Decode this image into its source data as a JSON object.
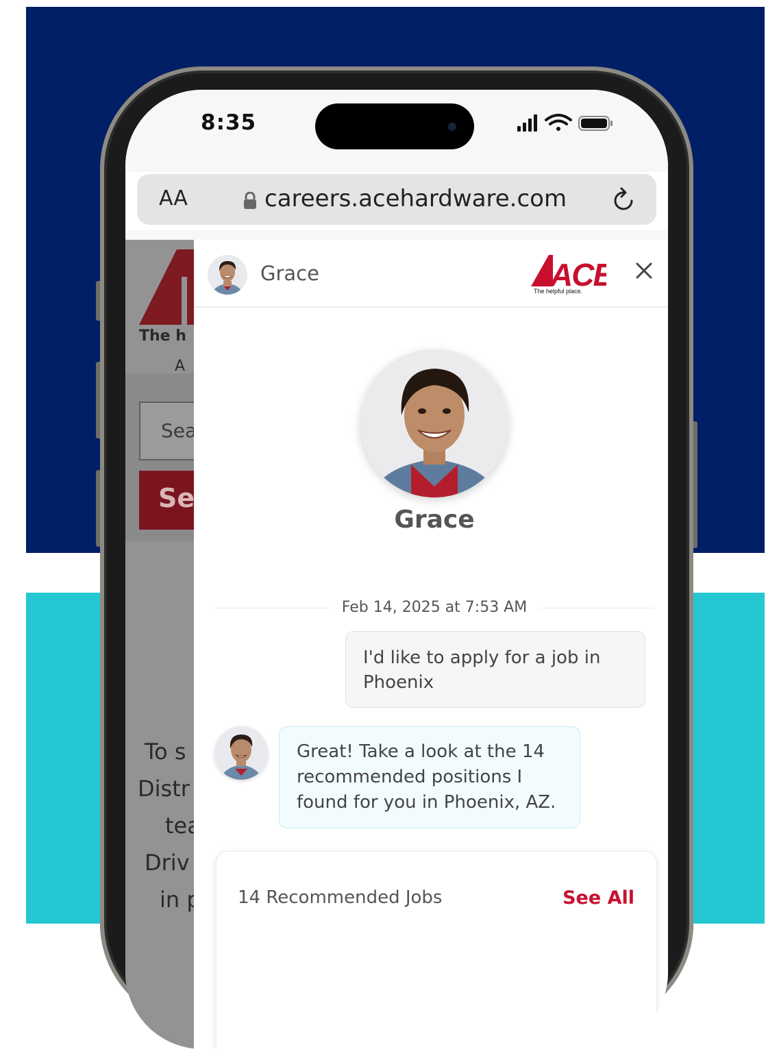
{
  "status_bar": {
    "time": "8:35"
  },
  "browser": {
    "text_size_label": "AA",
    "url": "careers.acehardware.com"
  },
  "background_page": {
    "logo_tagline_visible": "The h",
    "cut_text": "A c",
    "search_placeholder_visible": "Sea",
    "search_button_visible": "Se",
    "paragraph_lines_visible": [
      "To s",
      "Distr",
      "tea",
      "Driv",
      "in p"
    ]
  },
  "chat": {
    "header_name": "Grace",
    "logo": {
      "brand": "ACE",
      "tagline": "The helpful place.",
      "color": "#c8102e"
    },
    "assistant_name": "Grace",
    "timestamp": "Feb 14, 2025 at 7:53 AM",
    "messages": [
      {
        "from": "user",
        "text": "I'd like to apply for a job in Phoenix"
      },
      {
        "from": "assistant",
        "text": "Great! Take a look at the 14 recommended positions I found for you in Phoenix, AZ."
      }
    ],
    "jobs_card": {
      "title": "14 Recommended Jobs",
      "see_all_label": "See All"
    }
  },
  "colors": {
    "navy": "#001f66",
    "teal": "#25c8d2",
    "ace_red": "#c8102e"
  }
}
